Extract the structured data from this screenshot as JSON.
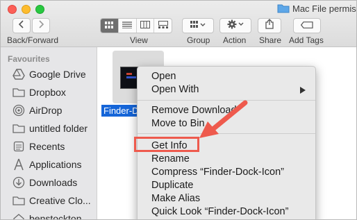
{
  "window": {
    "title": "Mac File permissio"
  },
  "toolbar": {
    "back_forward_label": "Back/Forward",
    "view_label": "View",
    "group_label": "Group",
    "action_label": "Action",
    "share_label": "Share",
    "add_tags_label": "Add Tags"
  },
  "sidebar": {
    "heading": "Favourites",
    "items": [
      {
        "label": "Google Drive",
        "icon": "google-drive-icon"
      },
      {
        "label": "Dropbox",
        "icon": "folder-icon"
      },
      {
        "label": "AirDrop",
        "icon": "airdrop-icon"
      },
      {
        "label": "untitled folder",
        "icon": "folder-icon"
      },
      {
        "label": "Recents",
        "icon": "recents-icon"
      },
      {
        "label": "Applications",
        "icon": "applications-icon"
      },
      {
        "label": "Downloads",
        "icon": "downloads-icon"
      },
      {
        "label": "Creative Clo...",
        "icon": "folder-icon"
      },
      {
        "label": "benstockton",
        "icon": "home-icon"
      }
    ]
  },
  "content": {
    "file_label": "Finder-D"
  },
  "context_menu": {
    "items": [
      "Open",
      "Open With",
      "Remove Download",
      "Move to Bin",
      "Get Info",
      "Rename",
      "Compress “Finder-Dock-Icon”",
      "Duplicate",
      "Make Alias",
      "Quick Look “Finder-Dock-Icon”"
    ]
  },
  "colors": {
    "selection_blue": "#1565d8",
    "annotation_red": "#ee5a4d"
  }
}
